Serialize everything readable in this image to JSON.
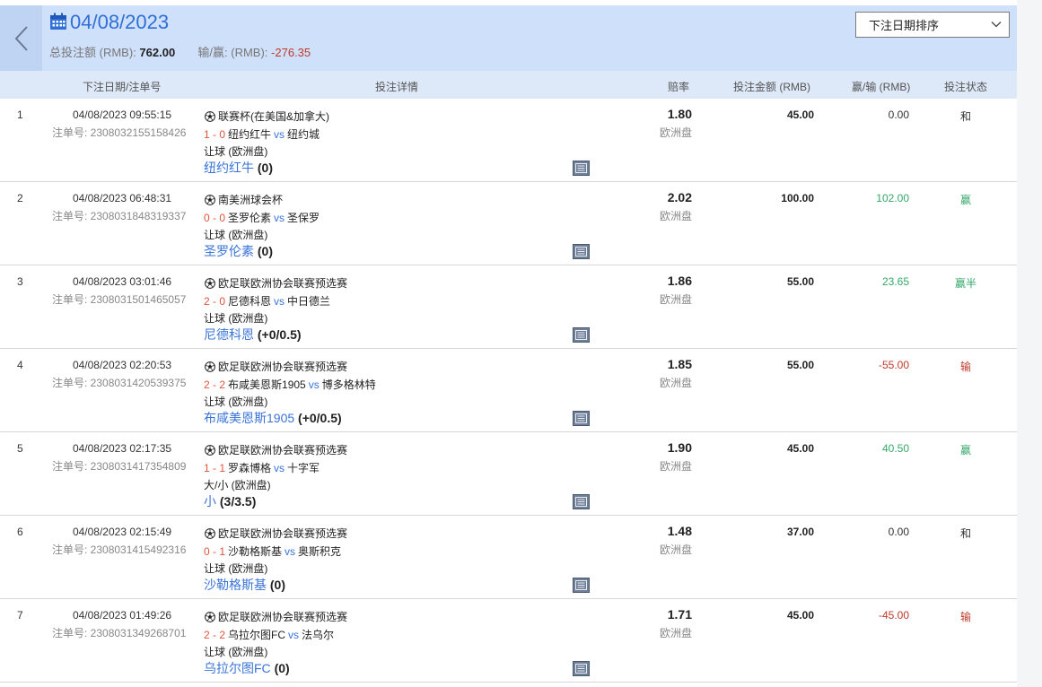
{
  "header": {
    "date_title": "04/08/2023",
    "total_stake_label": "总投注额 (RMB):",
    "total_stake_value": "762.00",
    "winloss_label": "输/赢: (RMB):",
    "winloss_value": "-276.35",
    "sort": {
      "selected": "下注日期排序"
    },
    "icons": {
      "back": "chevron-left-icon",
      "calendar": "calendar-icon",
      "dropdown": "chevron-down-icon"
    }
  },
  "columns": {
    "date_order": "下注日期/注单号",
    "details": "投注详情",
    "odds": "赔率",
    "stake": "投注金额 (RMB)",
    "winloss": "赢/输 (RMB)",
    "status": "投注状态"
  },
  "colors": {
    "accent": "#2f6fd6",
    "header_bg": "#cfe0fb",
    "win": "#35a86b",
    "lose": "#c0392b",
    "score": "#e0553c"
  },
  "bets": [
    {
      "index": "1",
      "datetime": "04/08/2023 09:55:15",
      "order_no": "注单号: 2308032155158426",
      "league": "联赛杯(在美国&加拿大)",
      "score": "1 - 0",
      "home": "纽约红牛",
      "vs": "vs",
      "away": "纽约城",
      "market": "让球 (欧洲盘)",
      "pick_team": "纽约红牛",
      "pick_hcp": "(0)",
      "odds": "1.80",
      "odds_type": "欧洲盘",
      "stake": "45.00",
      "winloss": "0.00",
      "status": "和",
      "tone": "neutral"
    },
    {
      "index": "2",
      "datetime": "04/08/2023 06:48:31",
      "order_no": "注单号: 2308031848319337",
      "league": "南美洲球会杯",
      "score": "0 - 0",
      "home": "圣罗伦素",
      "vs": "vs",
      "away": "圣保罗",
      "market": "让球 (欧洲盘)",
      "pick_team": "圣罗伦素",
      "pick_hcp": "(0)",
      "odds": "2.02",
      "odds_type": "欧洲盘",
      "stake": "100.00",
      "winloss": "102.00",
      "status": "赢",
      "tone": "win"
    },
    {
      "index": "3",
      "datetime": "04/08/2023 03:01:46",
      "order_no": "注单号: 2308031501465057",
      "league": "欧足联欧洲协会联赛预选赛",
      "score": "2 - 0",
      "home": "尼德科恩",
      "vs": "vs",
      "away": "中日德兰",
      "market": "让球 (欧洲盘)",
      "pick_team": "尼德科恩",
      "pick_hcp": "(+0/0.5)",
      "odds": "1.86",
      "odds_type": "欧洲盘",
      "stake": "55.00",
      "winloss": "23.65",
      "status": "赢半",
      "tone": "win"
    },
    {
      "index": "4",
      "datetime": "04/08/2023 02:20:53",
      "order_no": "注单号: 2308031420539375",
      "league": "欧足联欧洲协会联赛预选赛",
      "score": "2 - 2",
      "home": "布咸美恩斯1905",
      "vs": "vs",
      "away": "博多格林特",
      "market": "让球 (欧洲盘)",
      "pick_team": "布咸美恩斯1905",
      "pick_hcp": "(+0/0.5)",
      "odds": "1.85",
      "odds_type": "欧洲盘",
      "stake": "55.00",
      "winloss": "-55.00",
      "status": "输",
      "tone": "lose"
    },
    {
      "index": "5",
      "datetime": "04/08/2023 02:17:35",
      "order_no": "注单号: 2308031417354809",
      "league": "欧足联欧洲协会联赛预选赛",
      "score": "1 - 1",
      "home": "罗森博格",
      "vs": "vs",
      "away": "十字军",
      "market": "大/小 (欧洲盘)",
      "pick_team": "小",
      "pick_hcp": "(3/3.5)",
      "odds": "1.90",
      "odds_type": "欧洲盘",
      "stake": "45.00",
      "winloss": "40.50",
      "status": "赢",
      "tone": "win"
    },
    {
      "index": "6",
      "datetime": "04/08/2023 02:15:49",
      "order_no": "注单号: 2308031415492316",
      "league": "欧足联欧洲协会联赛预选赛",
      "score": "0 - 1",
      "home": "沙勒格斯基",
      "vs": "vs",
      "away": "奥斯积克",
      "market": "让球 (欧洲盘)",
      "pick_team": "沙勒格斯基",
      "pick_hcp": "(0)",
      "odds": "1.48",
      "odds_type": "欧洲盘",
      "stake": "37.00",
      "winloss": "0.00",
      "status": "和",
      "tone": "neutral"
    },
    {
      "index": "7",
      "datetime": "04/08/2023 01:49:26",
      "order_no": "注单号: 2308031349268701",
      "league": "欧足联欧洲协会联赛预选赛",
      "score": "2 - 2",
      "home": "乌拉尔图FC",
      "vs": "vs",
      "away": "法乌尔",
      "market": "让球 (欧洲盘)",
      "pick_team": "乌拉尔图FC",
      "pick_hcp": "(0)",
      "odds": "1.71",
      "odds_type": "欧洲盘",
      "stake": "45.00",
      "winloss": "-45.00",
      "status": "输",
      "tone": "lose"
    }
  ]
}
